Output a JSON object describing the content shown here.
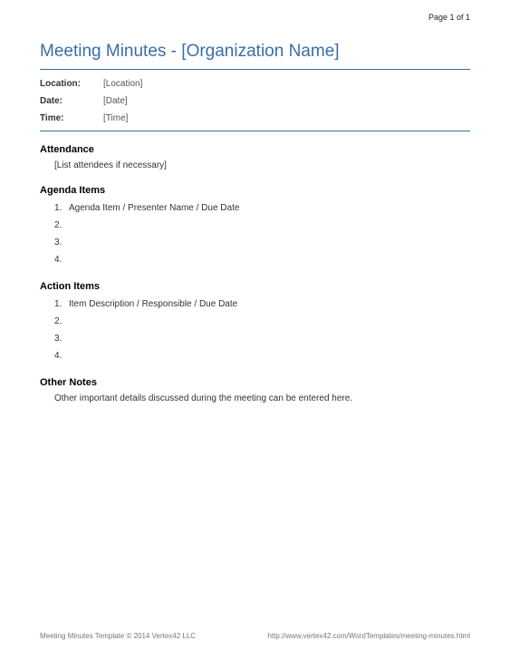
{
  "page_number": "Page 1 of 1",
  "title": "Meeting Minutes - [Organization Name]",
  "meta": {
    "location_label": "Location:",
    "location_value": "[Location]",
    "date_label": "Date:",
    "date_value": "[Date]",
    "time_label": "Time:",
    "time_value": "[Time]"
  },
  "sections": {
    "attendance": {
      "heading": "Attendance",
      "text": "[List attendees if necessary]"
    },
    "agenda": {
      "heading": "Agenda Items",
      "items": [
        "Agenda Item / Presenter Name / Due Date",
        "",
        "",
        ""
      ]
    },
    "action": {
      "heading": "Action Items",
      "items": [
        "Item Description / Responsible / Due Date",
        "",
        "",
        ""
      ]
    },
    "other": {
      "heading": "Other Notes",
      "text": "Other important details discussed during the meeting can be entered here."
    }
  },
  "footer": {
    "left": "Meeting Minutes Template © 2014 Vertex42 LLC",
    "right": "http://www.vertex42.com/WordTemplates/meeting-minutes.html"
  }
}
